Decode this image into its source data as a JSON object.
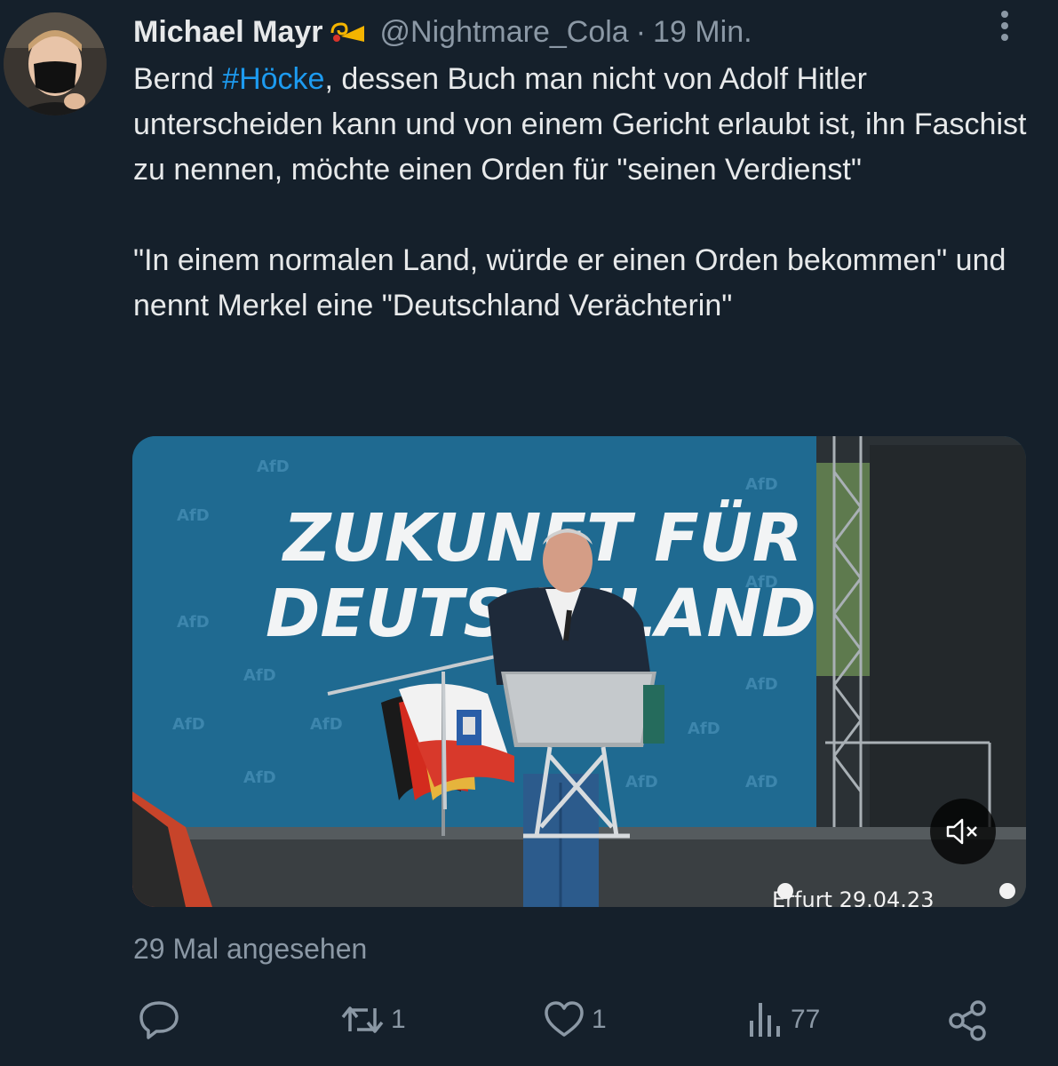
{
  "tweet": {
    "display_name": "Michael Mayr",
    "name_emoji": "postal-horn-icon",
    "handle": "@Nightmare_Cola",
    "separator": "·",
    "time": "19 Min.",
    "text_before_hashtag": "Bernd ",
    "hashtag": "#Höcke",
    "text_after_hashtag": ", dessen Buch man nicht von Adolf Hitler unterscheiden kann und von einem Gericht erlaubt ist, ihn Faschist zu nennen, möchte einen Orden für \"seinen Verdienst\"\n\n\"In einem normalen Land, würde er einen Orden bekommen\" und nennt Merkel eine \"Deutschland Verächterin\"",
    "views": "29 Mal angesehen"
  },
  "media": {
    "banner_line1": "ZUKUNFT FÜR",
    "banner_line2": "DEUTSCHLAND",
    "logo_text": "AfD",
    "caption": "Erfurt  29.04.23",
    "mute_icon": "speaker-muted-icon"
  },
  "actions": {
    "reply": {
      "icon": "reply-icon",
      "count": ""
    },
    "retweet": {
      "icon": "retweet-icon",
      "count": "1"
    },
    "like": {
      "icon": "heart-icon",
      "count": "1"
    },
    "views": {
      "icon": "analytics-icon",
      "count": "77"
    },
    "share": {
      "icon": "share-icon",
      "count": ""
    }
  },
  "colors": {
    "background": "#15202b",
    "text": "#e7e9ea",
    "secondary": "#8b98a5",
    "accent": "#1d9bf0"
  }
}
